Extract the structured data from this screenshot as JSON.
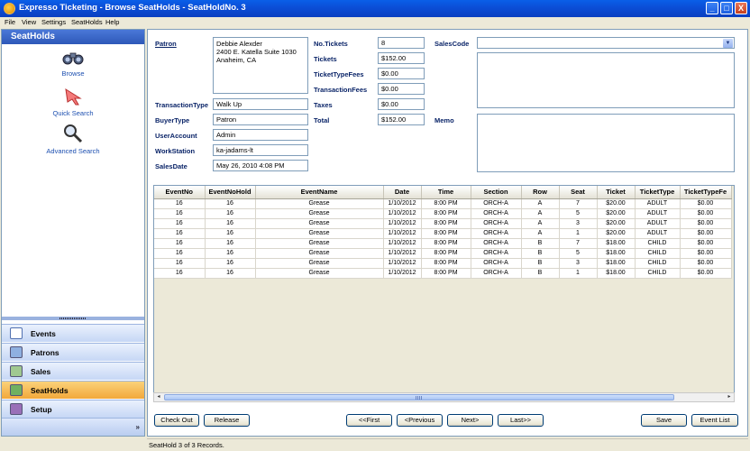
{
  "window": {
    "title": "Expresso Ticketing - Browse SeatHolds - SeatHoldNo. 3",
    "minimize": "_",
    "maximize": "□",
    "close": "X"
  },
  "menu": [
    "File",
    "View",
    "Settings",
    "SeatHolds",
    "Help"
  ],
  "sidebar": {
    "title": "SeatHolds",
    "actions": [
      {
        "label": "Browse",
        "icon": "binoculars-icon"
      },
      {
        "label": "Quick Search",
        "icon": "arrow-cursor-icon"
      },
      {
        "label": "Advanced Search",
        "icon": "magnifier-icon"
      }
    ],
    "nav": [
      {
        "label": "Events",
        "icon": "calendar-icon"
      },
      {
        "label": "Patrons",
        "icon": "patrons-icon"
      },
      {
        "label": "Sales",
        "icon": "sales-icon"
      },
      {
        "label": "SeatHolds",
        "icon": "seatholds-icon"
      },
      {
        "label": "Setup",
        "icon": "setup-icon"
      }
    ],
    "footer_chevron": "»"
  },
  "form": {
    "patron_label": "Patron",
    "patron_lines": [
      "Debbie Alexder",
      "2400 E. Katella Suite 1030",
      "Anaheim, CA"
    ],
    "transaction_type_label": "TransactionType",
    "transaction_type": "Walk Up",
    "buyer_type_label": "BuyerType",
    "buyer_type": "Patron",
    "user_account_label": "UserAccount",
    "user_account": "Admin",
    "workstation_label": "WorkStation",
    "workstation": "ka-jadams-lt",
    "sales_date_label": "SalesDate",
    "sales_date": "May 26, 2010  4:08  PM",
    "no_tickets_label": "No.Tickets",
    "no_tickets": "8",
    "tickets_label": "Tickets",
    "tickets": "$152.00",
    "ticket_type_fees_label": "TicketTypeFees",
    "ticket_type_fees": "$0.00",
    "transaction_fees_label": "TransactionFees",
    "transaction_fees": "$0.00",
    "taxes_label": "Taxes",
    "taxes": "$0.00",
    "total_label": "Total",
    "total": "$152.00",
    "sales_code_label": "SalesCode",
    "sales_code": "",
    "memo_label": "Memo",
    "memo": ""
  },
  "grid": {
    "columns": [
      "EventNo",
      "EventNoHold",
      "EventName",
      "Date",
      "Time",
      "Section",
      "Row",
      "Seat",
      "Ticket",
      "TicketType",
      "TicketTypeFe"
    ],
    "rows": [
      [
        "16",
        "16",
        "Grease",
        "1/10/2012",
        "8:00 PM",
        "ORCH-A",
        "A",
        "7",
        "$20.00",
        "ADULT",
        "$0.00"
      ],
      [
        "16",
        "16",
        "Grease",
        "1/10/2012",
        "8:00 PM",
        "ORCH-A",
        "A",
        "5",
        "$20.00",
        "ADULT",
        "$0.00"
      ],
      [
        "16",
        "16",
        "Grease",
        "1/10/2012",
        "8:00 PM",
        "ORCH-A",
        "A",
        "3",
        "$20.00",
        "ADULT",
        "$0.00"
      ],
      [
        "16",
        "16",
        "Grease",
        "1/10/2012",
        "8:00 PM",
        "ORCH-A",
        "A",
        "1",
        "$20.00",
        "ADULT",
        "$0.00"
      ],
      [
        "16",
        "16",
        "Grease",
        "1/10/2012",
        "8:00 PM",
        "ORCH-A",
        "B",
        "7",
        "$18.00",
        "CHILD",
        "$0.00"
      ],
      [
        "16",
        "16",
        "Grease",
        "1/10/2012",
        "8:00 PM",
        "ORCH-A",
        "B",
        "5",
        "$18.00",
        "CHILD",
        "$0.00"
      ],
      [
        "16",
        "16",
        "Grease",
        "1/10/2012",
        "8:00 PM",
        "ORCH-A",
        "B",
        "3",
        "$18.00",
        "CHILD",
        "$0.00"
      ],
      [
        "16",
        "16",
        "Grease",
        "1/10/2012",
        "8:00 PM",
        "ORCH-A",
        "B",
        "1",
        "$18.00",
        "CHILD",
        "$0.00"
      ]
    ],
    "scroll_left": "◂",
    "scroll_right": "▸"
  },
  "buttons": {
    "check_out": "Check Out",
    "release": "Release",
    "first": "<<First",
    "previous": "<Previous",
    "next": "Next>",
    "last": "Last>>",
    "save": "Save",
    "event_list": "Event List"
  },
  "status": "SeatHold 3 of 3 Records.",
  "colors": {
    "accent": "#0a4fd8",
    "active_nav": "#f2a83a",
    "label": "#0a2468"
  }
}
